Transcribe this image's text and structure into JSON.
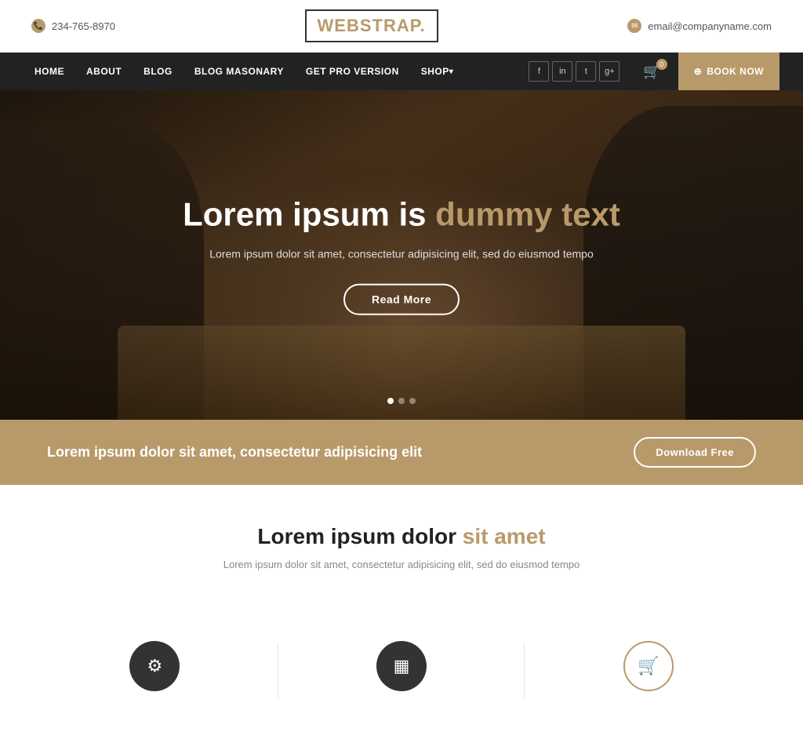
{
  "topbar": {
    "phone": "234-765-8970",
    "email": "email@companyname.com"
  },
  "logo": {
    "text_part1": "WEB",
    "text_part2": "STRAP.",
    "tagline": "."
  },
  "nav": {
    "links": [
      {
        "label": "HOME",
        "arrow": false
      },
      {
        "label": "ABOUT",
        "arrow": false
      },
      {
        "label": "BLOG",
        "arrow": false
      },
      {
        "label": "BLOG MASONARY",
        "arrow": false
      },
      {
        "label": "GET PRO VERSION",
        "arrow": false
      },
      {
        "label": "SHOP",
        "arrow": true
      }
    ],
    "social_icons": [
      "f",
      "in",
      "t",
      "g+"
    ],
    "cart_count": "0",
    "book_now": "Book Now"
  },
  "hero": {
    "title_plain": "Lorem ipsum is ",
    "title_accent": "dummy text",
    "subtitle": "Lorem ipsum dolor sit amet, consectetur adipisicing elit, sed do eiusmod tempo",
    "cta_button": "Read More",
    "dots": [
      true,
      false,
      false
    ]
  },
  "cta_banner": {
    "text": "Lorem ipsum dolor sit amet, consectetur adipisicing elit",
    "button": "Download Free"
  },
  "section": {
    "title_plain": "Lorem ipsum dolor ",
    "title_accent": "sit amet",
    "subtitle": "Lorem ipsum dolor sit amet, consectetur adipisicing elit, sed do eiusmod tempo"
  },
  "features": [
    {
      "icon": "⚙",
      "type": "dark"
    },
    {
      "icon": "▦",
      "type": "dark"
    },
    {
      "icon": "🛒",
      "type": "accent"
    }
  ]
}
